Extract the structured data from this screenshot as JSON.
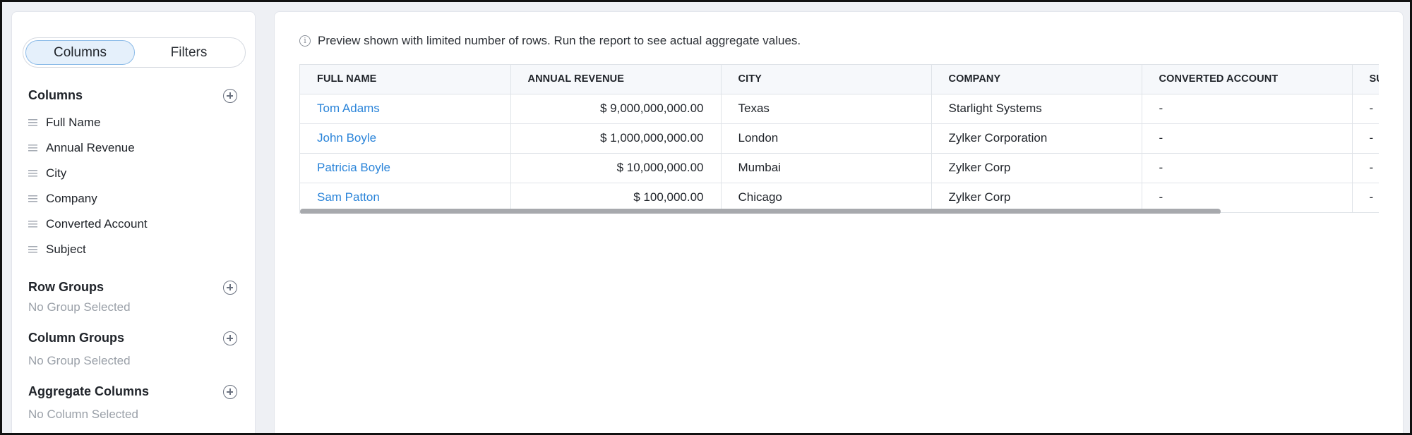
{
  "toggle": {
    "columns_label": "Columns",
    "filters_label": "Filters"
  },
  "columns_section": {
    "title": "Columns",
    "items": [
      {
        "label": "Full Name"
      },
      {
        "label": "Annual Revenue"
      },
      {
        "label": "City"
      },
      {
        "label": "Company"
      },
      {
        "label": "Converted Account"
      },
      {
        "label": "Subject"
      }
    ]
  },
  "row_groups": {
    "title": "Row Groups",
    "empty": "No Group Selected"
  },
  "column_groups": {
    "title": "Column Groups",
    "empty": "No Group Selected"
  },
  "aggregate_columns": {
    "title": "Aggregate Columns",
    "empty": "No Column Selected"
  },
  "preview_notice": "Preview shown with limited number of rows. Run the report to see actual aggregate values.",
  "table": {
    "headers": [
      "FULL NAME",
      "ANNUAL REVENUE",
      "CITY",
      "COMPANY",
      "CONVERTED ACCOUNT",
      "SUBJECT"
    ],
    "rows": [
      {
        "full_name": "Tom Adams",
        "annual_revenue": "$ 9,000,000,000.00",
        "city": "Texas",
        "company": "Starlight Systems",
        "converted_account": "-",
        "subject": "-"
      },
      {
        "full_name": "John Boyle",
        "annual_revenue": "$ 1,000,000,000.00",
        "city": "London",
        "company": "Zylker Corporation",
        "converted_account": "-",
        "subject": "-"
      },
      {
        "full_name": "Patricia Boyle",
        "annual_revenue": "$ 10,000,000.00",
        "city": "Mumbai",
        "company": "Zylker Corp",
        "converted_account": "-",
        "subject": "-"
      },
      {
        "full_name": "Sam Patton",
        "annual_revenue": "$ 100,000.00",
        "city": "Chicago",
        "company": "Zylker Corp",
        "converted_account": "-",
        "subject": "-"
      }
    ]
  },
  "colors": {
    "link": "#2a84d9",
    "toggle_active_bg": "#e5f0fb",
    "toggle_active_border": "#8cbbe8"
  }
}
